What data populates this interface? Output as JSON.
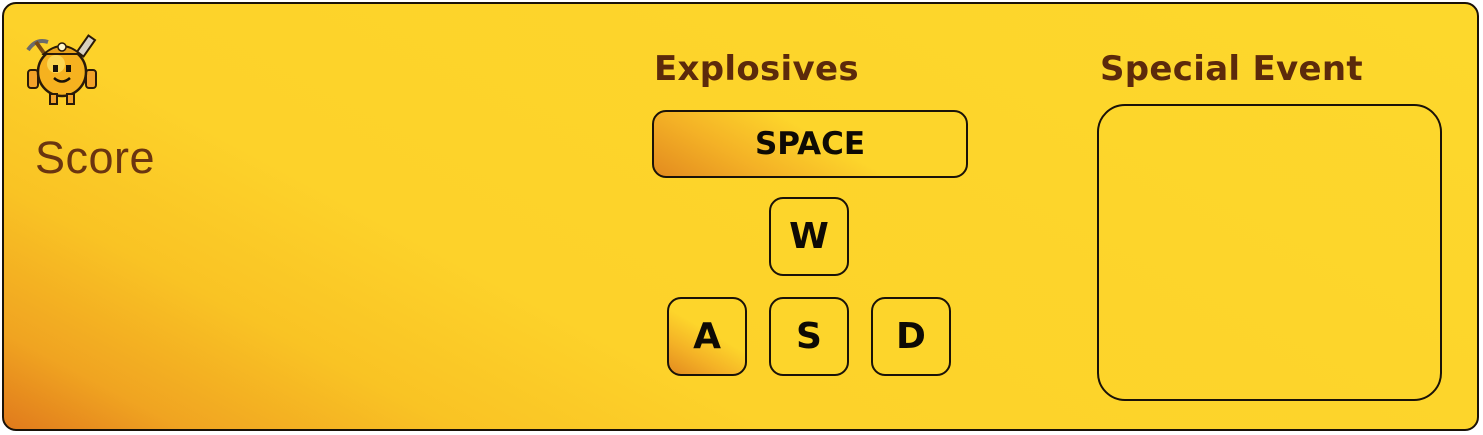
{
  "score": {
    "label": "Score"
  },
  "explosives": {
    "heading": "Explosives",
    "keys": {
      "space": "SPACE",
      "w": "W",
      "a": "A",
      "s": "S",
      "d": "D"
    }
  },
  "special_event": {
    "heading": "Special Event"
  },
  "icons": {
    "mascot": "miner-mascot-icon"
  },
  "colors": {
    "panel_top": "#fdd82c",
    "panel_corner": "#e07a1c",
    "heading_text": "#5c2a0b",
    "score_text": "#6a3510",
    "border": "#1a1208"
  }
}
